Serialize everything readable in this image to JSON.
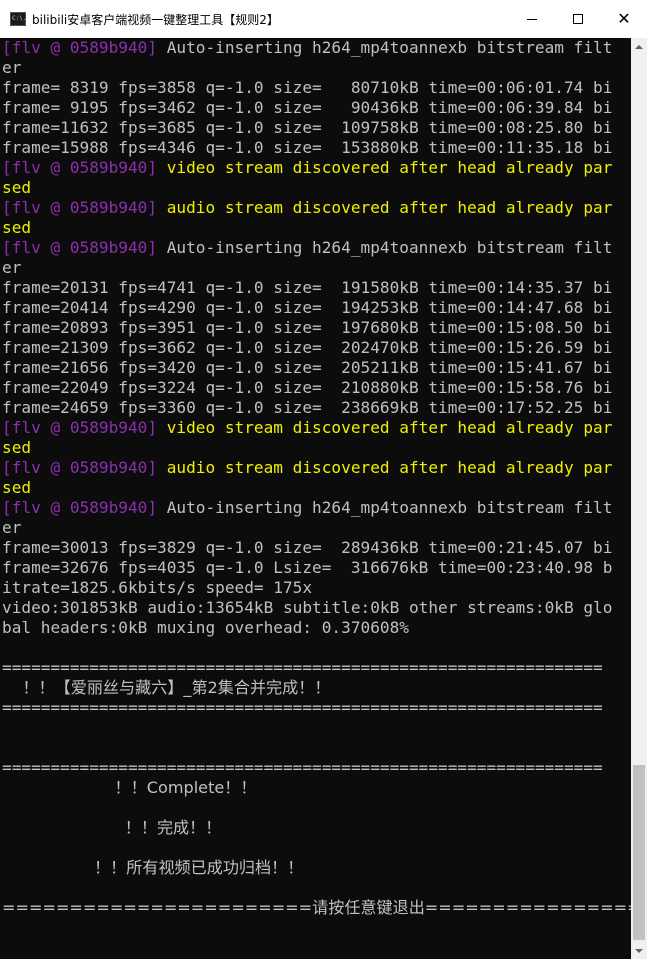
{
  "window": {
    "title": "bilibili安卓客户端视频一键整理工具【规则2】",
    "app_icon_text": "C:\\."
  },
  "colors": {
    "background": "#0c0c0c",
    "text": "#c0c0c0",
    "prefix": "#8b2fae",
    "warning": "#f0f000"
  },
  "console_lines": [
    {
      "prefix": "[flv @ 0589b940] ",
      "text": "Auto-inserting h264_mp4toannexb bitstream filt",
      "style": "normal"
    },
    {
      "prefix": "",
      "text": "er",
      "style": "normal"
    },
    {
      "prefix": "",
      "text": "frame= 8319 fps=3858 q=-1.0 size=   80710kB time=00:06:01.74 bi",
      "style": "normal"
    },
    {
      "prefix": "",
      "text": "frame= 9195 fps=3462 q=-1.0 size=   90436kB time=00:06:39.84 bi",
      "style": "normal"
    },
    {
      "prefix": "",
      "text": "frame=11632 fps=3685 q=-1.0 size=  109758kB time=00:08:25.80 bi",
      "style": "normal"
    },
    {
      "prefix": "",
      "text": "frame=15988 fps=4346 q=-1.0 size=  153880kB time=00:11:35.18 bi",
      "style": "normal"
    },
    {
      "prefix": "[flv @ 0589b940] ",
      "text": "video stream discovered after head already par",
      "style": "warning"
    },
    {
      "prefix": "",
      "text": "sed",
      "style": "warning"
    },
    {
      "prefix": "[flv @ 0589b940] ",
      "text": "audio stream discovered after head already par",
      "style": "warning"
    },
    {
      "prefix": "",
      "text": "sed",
      "style": "warning"
    },
    {
      "prefix": "[flv @ 0589b940] ",
      "text": "Auto-inserting h264_mp4toannexb bitstream filt",
      "style": "normal"
    },
    {
      "prefix": "",
      "text": "er",
      "style": "normal"
    },
    {
      "prefix": "",
      "text": "frame=20131 fps=4741 q=-1.0 size=  191580kB time=00:14:35.37 bi",
      "style": "normal"
    },
    {
      "prefix": "",
      "text": "frame=20414 fps=4290 q=-1.0 size=  194253kB time=00:14:47.68 bi",
      "style": "normal"
    },
    {
      "prefix": "",
      "text": "frame=20893 fps=3951 q=-1.0 size=  197680kB time=00:15:08.50 bi",
      "style": "normal"
    },
    {
      "prefix": "",
      "text": "frame=21309 fps=3662 q=-1.0 size=  202470kB time=00:15:26.59 bi",
      "style": "normal"
    },
    {
      "prefix": "",
      "text": "frame=21656 fps=3420 q=-1.0 size=  205211kB time=00:15:41.67 bi",
      "style": "normal"
    },
    {
      "prefix": "",
      "text": "frame=22049 fps=3224 q=-1.0 size=  210880kB time=00:15:58.76 bi",
      "style": "normal"
    },
    {
      "prefix": "",
      "text": "frame=24659 fps=3360 q=-1.0 size=  238669kB time=00:17:52.25 bi",
      "style": "normal"
    },
    {
      "prefix": "[flv @ 0589b940] ",
      "text": "video stream discovered after head already par",
      "style": "warning"
    },
    {
      "prefix": "",
      "text": "sed",
      "style": "warning"
    },
    {
      "prefix": "[flv @ 0589b940] ",
      "text": "audio stream discovered after head already par",
      "style": "warning"
    },
    {
      "prefix": "",
      "text": "sed",
      "style": "warning"
    },
    {
      "prefix": "[flv @ 0589b940] ",
      "text": "Auto-inserting h264_mp4toannexb bitstream filt",
      "style": "normal"
    },
    {
      "prefix": "",
      "text": "er",
      "style": "normal"
    },
    {
      "prefix": "",
      "text": "frame=30013 fps=3829 q=-1.0 size=  289436kB time=00:21:45.07 bi",
      "style": "normal"
    },
    {
      "prefix": "",
      "text": "frame=32676 fps=4035 q=-1.0 Lsize=  316676kB time=00:23:40.98 b",
      "style": "normal"
    },
    {
      "prefix": "",
      "text": "itrate=1825.6kbits/s speed= 175x",
      "style": "normal"
    },
    {
      "prefix": "",
      "text": "video:301853kB audio:13654kB subtitle:0kB other streams:0kB glo",
      "style": "normal"
    },
    {
      "prefix": "",
      "text": "bal headers:0kB muxing overhead: 0.370608%",
      "style": "normal"
    },
    {
      "prefix": "",
      "text": "",
      "style": "normal"
    },
    {
      "prefix": "",
      "text": "==============================================================",
      "style": "normal"
    },
    {
      "prefix": "",
      "text": "    ！！【爱丽丝与藏六】_第2集合并完成！！",
      "style": "normal"
    },
    {
      "prefix": "",
      "text": "==============================================================",
      "style": "normal"
    },
    {
      "prefix": "",
      "text": "",
      "style": "normal"
    },
    {
      "prefix": "",
      "text": "",
      "style": "normal"
    },
    {
      "prefix": "",
      "text": "==============================================================",
      "style": "normal"
    },
    {
      "prefix": "",
      "text": "                      ！！Complete！！",
      "style": "normal"
    },
    {
      "prefix": "",
      "text": "",
      "style": "normal"
    },
    {
      "prefix": "",
      "text": "                        ！！完成！！",
      "style": "normal"
    },
    {
      "prefix": "",
      "text": "",
      "style": "normal"
    },
    {
      "prefix": "",
      "text": "                  ！！所有视频已成功归档！！",
      "style": "normal"
    },
    {
      "prefix": "",
      "text": "",
      "style": "normal"
    },
    {
      "prefix": "",
      "text": "=======================请按任意键退出=========================",
      "style": "normal"
    }
  ]
}
